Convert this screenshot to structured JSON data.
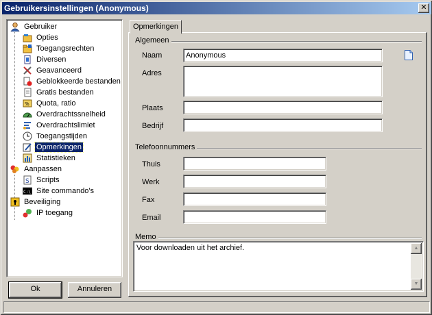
{
  "window": {
    "title": "Gebruikersinstellingen (Anonymous)",
    "close_label": "✕"
  },
  "tree": {
    "items": [
      {
        "label": "Gebruiker",
        "icon": "user-icon"
      },
      {
        "label": "Opties",
        "icon": "options-icon"
      },
      {
        "label": "Toegangsrechten",
        "icon": "folder-access-icon"
      },
      {
        "label": "Diversen",
        "icon": "misc-icon"
      },
      {
        "label": "Geavanceerd",
        "icon": "tools-icon"
      },
      {
        "label": "Geblokkeerde bestanden",
        "icon": "blocked-file-icon"
      },
      {
        "label": "Gratis bestanden",
        "icon": "free-file-icon"
      },
      {
        "label": "Quota, ratio",
        "icon": "quota-icon"
      },
      {
        "label": "Overdrachtssnelheid",
        "icon": "speed-icon"
      },
      {
        "label": "Overdrachtslimiet",
        "icon": "limit-icon"
      },
      {
        "label": "Toegangstijden",
        "icon": "clock-icon"
      },
      {
        "label": "Opmerkingen",
        "icon": "notes-icon"
      },
      {
        "label": "Statistieken",
        "icon": "stats-icon"
      },
      {
        "label": "Aanpassen",
        "icon": "customize-icon"
      },
      {
        "label": "Scripts",
        "icon": "script-icon"
      },
      {
        "label": "Site commando's",
        "icon": "console-icon"
      },
      {
        "label": "Beveiliging",
        "icon": "security-icon"
      },
      {
        "label": "IP toegang",
        "icon": "ip-access-icon"
      }
    ],
    "selected": "Opmerkingen"
  },
  "buttons": {
    "ok": "Ok",
    "cancel": "Annuleren"
  },
  "tab": {
    "label": "Opmerkingen"
  },
  "general": {
    "title": "Algemeen",
    "name_label": "Naam",
    "name_value": "Anonymous",
    "address_label": "Adres",
    "address_value": "",
    "city_label": "Plaats",
    "city_value": "",
    "company_label": "Bedrijf",
    "company_value": ""
  },
  "phones": {
    "title": "Telefoonnummers",
    "home_label": "Thuis",
    "home_value": "",
    "work_label": "Werk",
    "work_value": "",
    "fax_label": "Fax",
    "fax_value": "",
    "email_label": "Email",
    "email_value": ""
  },
  "memo": {
    "title": "Memo",
    "value": "Voor downloaden uit het archief."
  },
  "colors": {
    "titlebar_start": "#0a246a",
    "titlebar_end": "#a6caf0",
    "selection": "#0a246a",
    "face": "#d4d0c8"
  }
}
